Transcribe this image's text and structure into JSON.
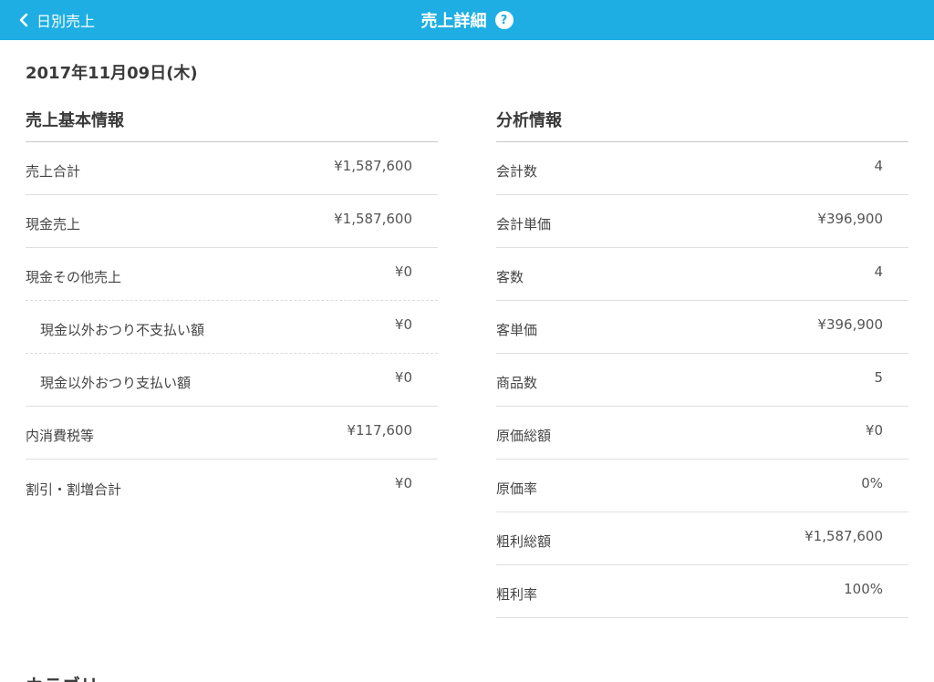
{
  "nav": {
    "back_label": "日別売上",
    "title": "売上詳細",
    "help_glyph": "?"
  },
  "date": "2017年11月09日(木)",
  "basic": {
    "header": "売上基本情報",
    "rows": [
      {
        "label": "売上合計",
        "value": "¥1,587,600"
      },
      {
        "label": "現金売上",
        "value": "¥1,587,600"
      },
      {
        "label": "現金その他売上",
        "value": "¥0"
      },
      {
        "label": "現金以外おつり不支払い額",
        "value": "¥0"
      },
      {
        "label": "現金以外おつり支払い額",
        "value": "¥0"
      },
      {
        "label": "内消費税等",
        "value": "¥117,600"
      },
      {
        "label": "割引・割増合計",
        "value": "¥0"
      }
    ]
  },
  "analysis": {
    "header": "分析情報",
    "rows": [
      {
        "label": "会計数",
        "value": "4"
      },
      {
        "label": "会計単価",
        "value": "¥396,900"
      },
      {
        "label": "客数",
        "value": "4"
      },
      {
        "label": "客単価",
        "value": "¥396,900"
      },
      {
        "label": "商品数",
        "value": "5"
      },
      {
        "label": "原価総額",
        "value": "¥0"
      },
      {
        "label": "原価率",
        "value": "0%"
      },
      {
        "label": "粗利総額",
        "value": "¥1,587,600"
      },
      {
        "label": "粗利率",
        "value": "100%"
      }
    ]
  },
  "category_header": "カテゴリー"
}
